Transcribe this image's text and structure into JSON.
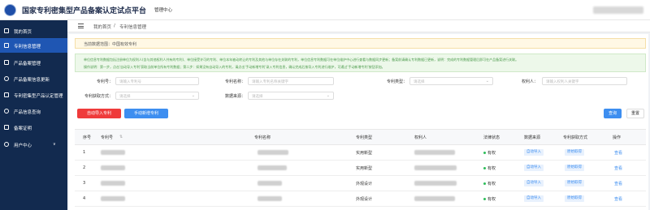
{
  "header": {
    "app_title": "国家专利密集型产品备案认定试点平台",
    "app_subtitle": "管理中心"
  },
  "sidebar": {
    "items": [
      {
        "label": "我的首页",
        "icon": "home-icon"
      },
      {
        "label": "专利信息管理",
        "icon": "document-icon"
      },
      {
        "label": "产品备案管理",
        "icon": "folder-icon"
      },
      {
        "label": "产品备案信息更新",
        "icon": "refresh-icon"
      },
      {
        "label": "专利密集型产品认定管理",
        "icon": "certificate-icon"
      },
      {
        "label": "产品信息查询",
        "icon": "search-icon"
      },
      {
        "label": "备案证明",
        "icon": "stamp-icon"
      },
      {
        "label": "用户中心",
        "icon": "user-icon",
        "chevron": "∨"
      }
    ]
  },
  "breadcrumb": {
    "home": "我的首页",
    "sep": "/",
    "current": "专利信息管理"
  },
  "notice": {
    "scope": "当前数据范围：中国有效专利",
    "line1": "单位信息专利数据包括注册单位为权利人(含与其他权利人共有的专利)、单位接受许可的专利、单位本年被动转让的专利及其他与单位存在关联的专利，单位信息专利数据可在单位维护中心进行查看与数据同步更新；备案前请确认专利数据已更新，说明：完成的专利数据管理后即可在产品备案进行关联。",
    "line2": "操作说明：第一步，点击'自动导入专利'获取当前单位所有专利数据；第二步：如果没有自动导入的专利，请点击'手动新增专利'录入专利信息，确认完成后按导入专利进行维护，可通过'手动新增专利'按钮添加。"
  },
  "filters": {
    "patent_no": {
      "label": "专利号：",
      "placeholder": "请输入专利号"
    },
    "patent_name": {
      "label": "专利名称：",
      "placeholder": "请输入专利名称关键字"
    },
    "patent_type": {
      "label": "专利类型：",
      "placeholder": "请选择"
    },
    "owner": {
      "label": "权利人：",
      "placeholder": "请输入权利人关键字"
    },
    "acquire_method": {
      "label": "专利获取方式：",
      "placeholder": "请选择"
    },
    "data_source": {
      "label": "数据来源：",
      "placeholder": "请选择"
    }
  },
  "actions": {
    "auto_import": "自动导入专利",
    "manual_add": "手动新增专利",
    "search": "查询",
    "reset": "重置"
  },
  "table": {
    "headers": [
      "序号",
      "专利号",
      "专利名称",
      "专利类型",
      "权利人",
      "法律状态",
      "数据来源",
      "专利获取方式",
      "操作"
    ],
    "rows": [
      {
        "index": "1",
        "type": "实用新型",
        "status": "有权",
        "source": "自动导入",
        "method": "原始取得",
        "action": "查看"
      },
      {
        "index": "2",
        "type": "实用新型",
        "status": "有权",
        "source": "自动导入",
        "method": "原始取得",
        "action": "查看"
      },
      {
        "index": "3",
        "type": "外观设计",
        "status": "有权",
        "source": "自动导入",
        "method": "原始取得",
        "action": "查看"
      },
      {
        "index": "4",
        "type": "外观设计",
        "status": "有权",
        "source": "自动导入",
        "method": "原始取得",
        "action": "查看"
      }
    ]
  },
  "colors": {
    "sidebar_bg": "#122a4f",
    "sidebar_active": "#1f56b3",
    "primary": "#3d8ef0",
    "danger": "#ef3b3b",
    "success": "#2dbd5a"
  }
}
